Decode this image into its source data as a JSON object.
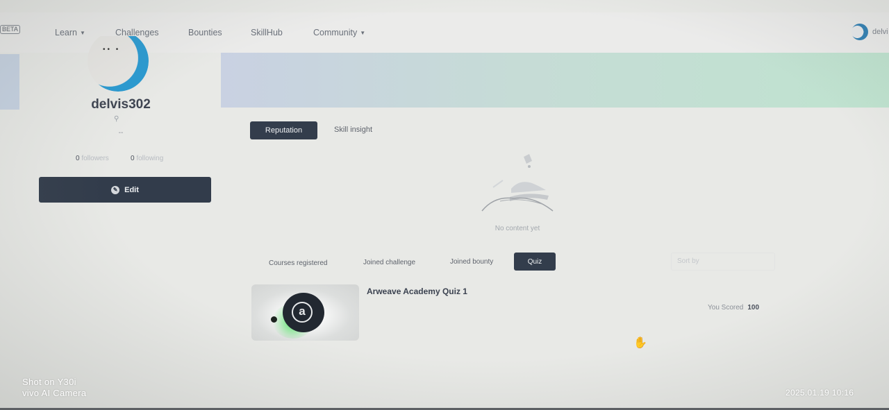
{
  "nav": {
    "badge": "BETA",
    "items": [
      {
        "label": "Learn",
        "dropdown": true
      },
      {
        "label": "Challenges",
        "dropdown": false
      },
      {
        "label": "Bounties",
        "dropdown": false
      },
      {
        "label": "SkillHub",
        "dropdown": false
      },
      {
        "label": "Community",
        "dropdown": true
      }
    ],
    "user_short": "delvi"
  },
  "profile": {
    "username": "delvis302",
    "location": "--",
    "followers_count": "0",
    "followers_label": "followers",
    "following_count": "0",
    "following_label": "following",
    "edit_label": "Edit"
  },
  "tabs": {
    "primary": [
      {
        "label": "Reputation",
        "active": true
      },
      {
        "label": "Skill insight",
        "active": false
      }
    ],
    "empty_text": "No content yet",
    "secondary": [
      {
        "label": "Courses registered",
        "active": false
      },
      {
        "label": "Joined challenge",
        "active": false
      },
      {
        "label": "Joined bounty",
        "active": false
      },
      {
        "label": "Quiz",
        "active": true
      }
    ],
    "sort_placeholder": "Sort by"
  },
  "quiz": {
    "title": "Arweave Academy Quiz 1",
    "logo_letter": "a",
    "score_label": "You Scored",
    "score_value": "100"
  },
  "watermark": {
    "line1": "Shot on Y30i",
    "line2": "vivo AI Camera",
    "datetime": "2025.01.19 10:16"
  },
  "colors": {
    "dark_button": "#333d4c",
    "avatar_blue": "#2a9ad1",
    "glow_green": "#30dc46"
  }
}
